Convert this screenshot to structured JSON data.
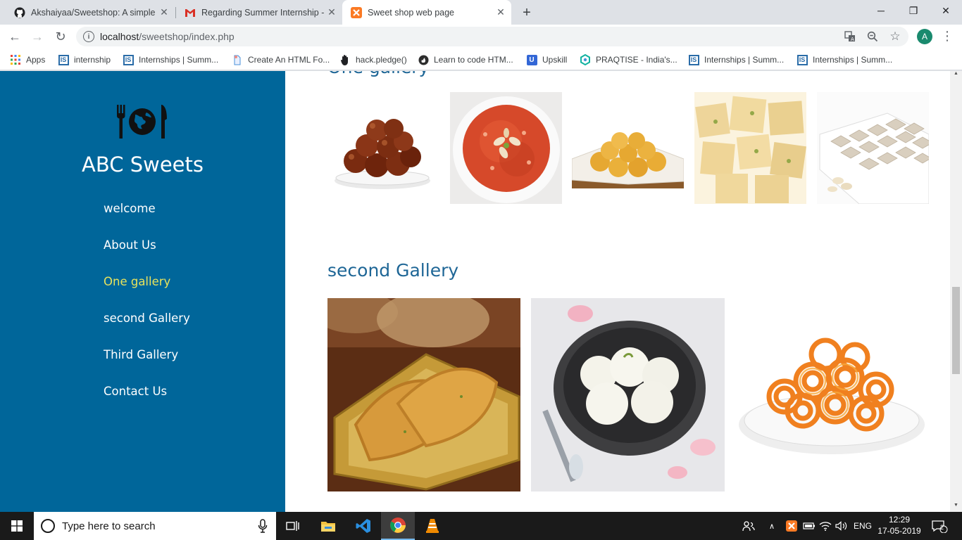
{
  "browser": {
    "tabs": [
      {
        "title": "Akshaiyaa/Sweetshop: A simple w",
        "favicon": "github-icon",
        "active": false
      },
      {
        "title": "Regarding Summer Internship - a",
        "favicon": "gmail-icon",
        "active": false
      },
      {
        "title": "Sweet shop web page",
        "favicon": "xampp-icon",
        "active": true
      }
    ],
    "address": {
      "host": "localhost",
      "path": "/sweetshop/index.php"
    },
    "profile_initial": "A",
    "bookmarks": [
      {
        "label": "Apps",
        "icon": "apps-grid-icon"
      },
      {
        "label": "internship",
        "icon": "internshala-icon"
      },
      {
        "label": "Internships | Summ...",
        "icon": "internshala-icon"
      },
      {
        "label": "Create An HTML Fo...",
        "icon": "page-icon"
      },
      {
        "label": "hack.pledge()",
        "icon": "hand-icon"
      },
      {
        "label": "Learn to code HTM...",
        "icon": "freecodecamp-icon"
      },
      {
        "label": "Upskill",
        "icon": "upskill-icon"
      },
      {
        "label": "PRAQTISE - India's...",
        "icon": "praqtise-icon"
      },
      {
        "label": "Internships | Summ...",
        "icon": "internshala-icon"
      },
      {
        "label": "Internships | Summ...",
        "icon": "internshala-icon"
      }
    ]
  },
  "site": {
    "brand": "ABC Sweets",
    "logo_icon": "fork-globe-knife-icon",
    "nav": [
      {
        "label": "welcome",
        "active": false
      },
      {
        "label": "About Us",
        "active": false
      },
      {
        "label": "One gallery",
        "active": true
      },
      {
        "label": "second Gallery",
        "active": false
      },
      {
        "label": "Third Gallery",
        "active": false
      },
      {
        "label": "Contact Us",
        "active": false
      }
    ],
    "sections": {
      "one": {
        "title": "One gallery",
        "images": [
          "gulab jamun",
          "carrot halwa",
          "besan laddoo",
          "soan papdi",
          "kaju katli"
        ]
      },
      "second": {
        "title": "second Gallery",
        "images": [
          "gujiya",
          "rasgulla",
          "jalebi"
        ]
      }
    },
    "colors": {
      "sidebar": "#00669a",
      "active_nav": "#e8e35c",
      "heading": "#1e6696"
    }
  },
  "taskbar": {
    "search_placeholder": "Type here to search",
    "language": "ENG",
    "time": "12:29",
    "date": "17-05-2019",
    "notifications": "2"
  }
}
